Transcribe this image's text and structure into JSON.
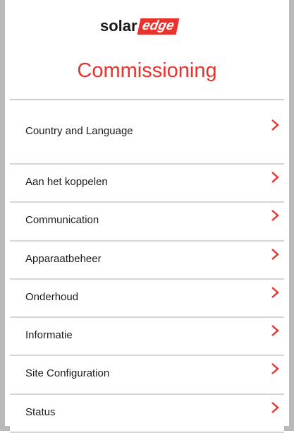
{
  "header": {
    "logo_solar": "solar",
    "logo_edge": "edge",
    "title": "Commissioning"
  },
  "menu": {
    "items": [
      {
        "label": "Country and Language",
        "icon": "chevron-right-icon"
      },
      {
        "label": "Aan het koppelen",
        "icon": "chevron-right-icon"
      },
      {
        "label": "Communication",
        "icon": "chevron-right-icon"
      },
      {
        "label": "Apparaatbeheer",
        "icon": "chevron-right-icon"
      },
      {
        "label": "Onderhoud",
        "icon": "chevron-right-icon"
      },
      {
        "label": "Informatie",
        "icon": "chevron-right-icon"
      },
      {
        "label": "Site Configuration",
        "icon": "chevron-right-icon"
      },
      {
        "label": "Status",
        "icon": "chevron-right-icon"
      }
    ]
  },
  "colors": {
    "accent": "#e8322c",
    "frame": "#b9b9b9",
    "divider": "#d6d6d6"
  }
}
